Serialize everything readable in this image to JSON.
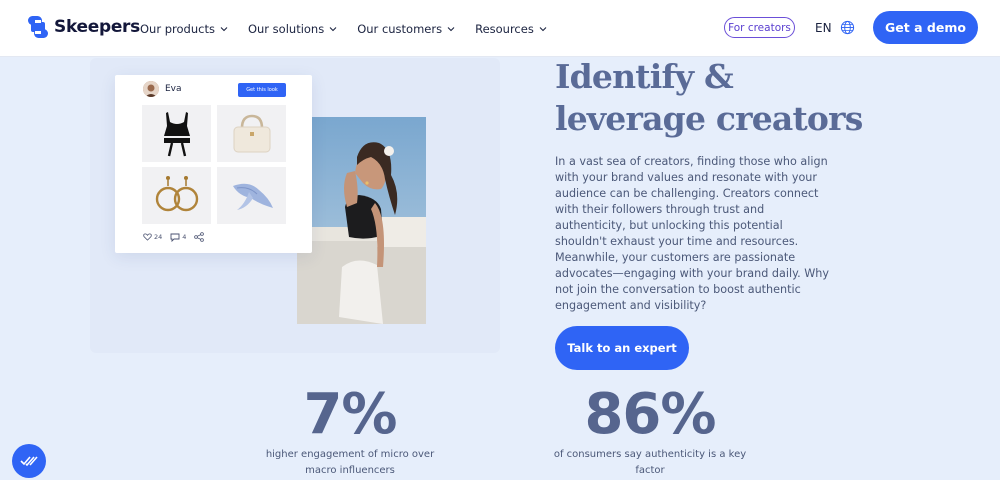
{
  "brand": {
    "name": "Skeepers",
    "color": "#2f64f5"
  },
  "nav": {
    "menu": [
      {
        "label": "Our products"
      },
      {
        "label": "Our solutions"
      },
      {
        "label": "Our customers"
      },
      {
        "label": "Resources"
      }
    ],
    "creators_label": "For creators",
    "language": "EN",
    "demo_label": "Get a demo"
  },
  "look_card": {
    "user": "Eva",
    "button_label": "Get this look",
    "likes": "24",
    "comments": "4",
    "items": [
      "crop-top-icon",
      "handbag-icon",
      "hoop-earrings-icon",
      "scarf-icon"
    ]
  },
  "hero": {
    "headline_line1": "Identify &",
    "headline_line2": "leverage creators",
    "paragraph": "In a vast sea of creators, finding those who align with your brand values and resonate with your audience can be challenging. Creators connect with their followers through trust and authenticity, but unlocking this potential shouldn't exhaust your time and resources. Meanwhile, your customers are passionate advocates—engaging with your brand daily. Why not join the conversation to boost authentic engagement and visibility?",
    "cta_label": "Talk to an expert"
  },
  "stats": [
    {
      "value": "7%",
      "caption": "higher engagement of micro over macro influencers"
    },
    {
      "value": "86%",
      "caption": "of consumers say authenticity is a key factor"
    }
  ]
}
